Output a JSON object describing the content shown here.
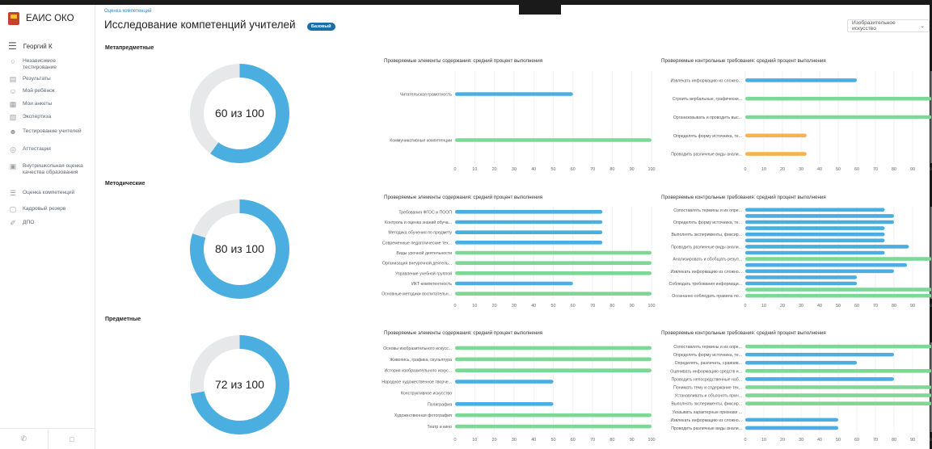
{
  "app": {
    "title": "ЕАИС ОКО"
  },
  "user": {
    "name": "Георгий К"
  },
  "nav": {
    "items": [
      {
        "icon": "shield-icon",
        "glyph": "○",
        "label": "Независимое тестирование"
      },
      {
        "icon": "results-icon",
        "glyph": "▤",
        "label": "Результаты"
      },
      {
        "icon": "child-icon",
        "glyph": "☺",
        "label": "Мой ребёнок"
      },
      {
        "icon": "survey-icon",
        "glyph": "▦",
        "label": "Мои анкеты"
      },
      {
        "icon": "expertise-icon",
        "glyph": "▧",
        "label": "Экспертиза"
      },
      {
        "icon": "teacher-test-icon",
        "glyph": "☻",
        "label": "Тестирование учителей"
      },
      {
        "icon": "attestation-icon",
        "glyph": "◎",
        "label": "Аттестация"
      },
      {
        "icon": "school-icon",
        "glyph": "▣",
        "label": "Внутришкольная оценка качества образования"
      },
      {
        "icon": "competence-icon",
        "glyph": "☰",
        "label": "Оценка компетенций"
      },
      {
        "icon": "reserve-icon",
        "glyph": "▢",
        "label": "Кадровый резерв"
      },
      {
        "icon": "dpo-icon",
        "glyph": "✐",
        "label": "ДПО"
      }
    ]
  },
  "footer": {
    "phone_icon": "✆",
    "map_icon": "□"
  },
  "page": {
    "breadcrumb": "Оценка компетенций",
    "title": "Исследование компетенций учителей",
    "badge": "Базовый",
    "subject_select": "Изобразительное искусство"
  },
  "colors": {
    "blue": "#4aaee0",
    "green": "#7ed895",
    "orange": "#f5b24f",
    "ring_bg": "#e7e8ea"
  },
  "chart_data": [
    {
      "section": "Метапредметные",
      "type": "donut",
      "label": "60 из 100",
      "value": 60,
      "max": 100
    },
    {
      "section": "Метапредметные",
      "type": "bar",
      "orientation": "horizontal",
      "title": "Проверяемые элементы содержания: средний процент выполнения",
      "xlim": [
        0,
        100
      ],
      "xticks": [
        0,
        10,
        20,
        30,
        40,
        50,
        60,
        70,
        80,
        90,
        100
      ],
      "categories": [
        "Читательская грамотность",
        "Коммуникативные компетенции"
      ],
      "values": [
        60,
        100
      ],
      "colors": [
        "blue",
        "green"
      ]
    },
    {
      "section": "Метапредметные",
      "type": "bar",
      "orientation": "horizontal",
      "title": "Проверяемые контрольные требования: средний процент выполнения",
      "xlim": [
        0,
        100
      ],
      "xticks": [
        0,
        10,
        20,
        30,
        40,
        50,
        60,
        70,
        80,
        90,
        10
      ],
      "categories": [
        "Извлекать информацию из сложно...",
        "Строить вербальные, графически...",
        "Организовывать и проводить выс...",
        "Определять форму источника, те...",
        "Проводить различные виды анали..."
      ],
      "values": [
        60,
        100,
        100,
        33,
        33
      ],
      "colors": [
        "blue",
        "green",
        "green",
        "orange",
        "orange"
      ]
    },
    {
      "section": "Методические",
      "type": "donut",
      "label": "80 из 100",
      "value": 80,
      "max": 100
    },
    {
      "section": "Методические",
      "type": "bar",
      "orientation": "horizontal",
      "title": "Проверяемые элементы содержания: средний процент выполнения",
      "xlim": [
        0,
        100
      ],
      "xticks": [
        0,
        10,
        20,
        30,
        40,
        50,
        60,
        70,
        80,
        90,
        100
      ],
      "categories": [
        "Требования ФГОС и ПООП",
        "Контроль и оценка знаний обуча...",
        "Методика обучения по предмету",
        "Современные педагогические тех...",
        "Виды урочной деятельности",
        "Организация внеурочной деятель...",
        "Управление учебной группой",
        "ИКТ-компетентность",
        "Основные методики воспитательн..."
      ],
      "values": [
        75,
        75,
        75,
        75,
        100,
        100,
        100,
        60,
        100
      ],
      "colors": [
        "blue",
        "blue",
        "blue",
        "blue",
        "green",
        "green",
        "green",
        "blue",
        "green"
      ]
    },
    {
      "section": "Методические",
      "type": "bar",
      "orientation": "horizontal",
      "title": "Проверяемые контрольные требования: средний процент выполнения",
      "xlim": [
        0,
        100
      ],
      "xticks": [
        0,
        10,
        20,
        30,
        40,
        50,
        60,
        70,
        80,
        90,
        10
      ],
      "categories": [
        "Сопоставлять термины и их опре...",
        "",
        "Определять форму источника, те...",
        "",
        "Выполнять эксперименты, фиксир...",
        "",
        "Проводить различные виды анали...",
        "",
        "Анализировать и обобщать резул...",
        "",
        "Извлекать информацию из сложно...",
        "",
        "Соблюдать требования информаци...",
        "",
        "Осознанно соблюдать правила по..."
      ],
      "values": [
        75,
        80,
        80,
        75,
        75,
        75,
        88,
        75,
        100,
        87,
        80,
        60,
        60,
        100,
        100
      ],
      "colors": [
        "blue",
        "blue",
        "blue",
        "blue",
        "blue",
        "blue",
        "blue",
        "blue",
        "green",
        "blue",
        "blue",
        "blue",
        "blue",
        "green",
        "green"
      ]
    },
    {
      "section": "Предметные",
      "type": "donut",
      "label": "72 из 100",
      "value": 72,
      "max": 100
    },
    {
      "section": "Предметные",
      "type": "bar",
      "orientation": "horizontal",
      "title": "Проверяемые элементы содержания: средний процент выполнения",
      "xlim": [
        0,
        100
      ],
      "xticks": [
        0,
        10,
        20,
        30,
        40,
        50,
        60,
        70,
        80,
        90,
        100
      ],
      "categories": [
        "Основы изобразительного искусс...",
        "Живопись, графика, скульптура",
        "История изобразительного искус...",
        "Народное художественное творче...",
        "Конструктивное искусство",
        "Полиграфия",
        "Художественная фотография",
        "Театр и кино"
      ],
      "values": [
        100,
        100,
        100,
        50,
        0,
        50,
        100,
        100
      ],
      "colors": [
        "green",
        "green",
        "green",
        "blue",
        "blue",
        "blue",
        "green",
        "green"
      ]
    },
    {
      "section": "Предметные",
      "type": "bar",
      "orientation": "horizontal",
      "title": "Проверяемые контрольные требования: средний процент выполнения",
      "xlim": [
        0,
        100
      ],
      "xticks": [
        0,
        10,
        20,
        30,
        40,
        50,
        60,
        70,
        80,
        90,
        10
      ],
      "categories": [
        "Сопоставлять термины и их опре...",
        "Определять форму источника, те...",
        "Определять, различать, сравнив...",
        "Оценивать информацию средств и...",
        "Проводить непосредственные наб...",
        "Понимать тему и содержание тек...",
        "Устанавливать и объяснять прич...",
        "Выполнять эксперименты, фиксир...",
        "Указывать характерные признаки ...",
        "Извлекать информацию из сложно...",
        "Проводить различные виды анали..."
      ],
      "values": [
        100,
        80,
        60,
        100,
        80,
        100,
        100,
        100,
        null,
        50,
        50
      ],
      "colors": [
        "green",
        "blue",
        "blue",
        "green",
        "blue",
        "green",
        "green",
        "green",
        "blue",
        "blue",
        "blue"
      ]
    }
  ]
}
